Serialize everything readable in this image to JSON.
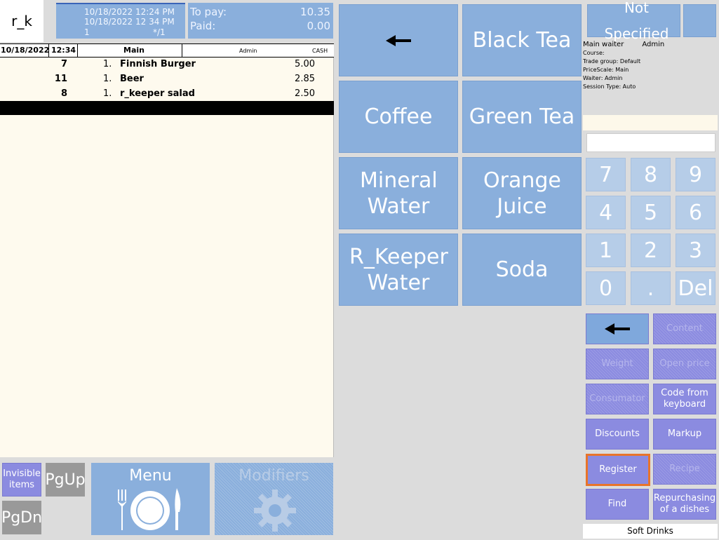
{
  "app": {
    "logo_text": "r_k"
  },
  "header": {
    "time_opened": "10/18/2022 12:24 PM",
    "time_current": "10/18/2022 12 34 PM",
    "guest_count": "1",
    "table_info": "*/1",
    "to_pay_label": "To pay:",
    "to_pay_value": "10.35",
    "paid_label": "Paid:",
    "paid_value": "0.00"
  },
  "order": {
    "date": "10/18/2022",
    "time": "12:34",
    "hall": "Main",
    "waiter": "Admin",
    "currency": "CASH",
    "items": [
      {
        "code": "7",
        "qty": "1.",
        "name": "Finnish Burger",
        "price": "5.00"
      },
      {
        "code": "11",
        "qty": "1.",
        "name": "Beer",
        "price": "2.85"
      },
      {
        "code": "8",
        "qty": "1.",
        "name": "r_keeper salad",
        "price": "2.50"
      }
    ]
  },
  "menu_grid": {
    "back_icon": "left-arrow-icon",
    "items": [
      "Black Tea",
      "Coffee",
      "Green Tea",
      "Mineral Water",
      "Orange Juice",
      "R_Keeper Water",
      "Soda"
    ]
  },
  "right_panel": {
    "customer": "Not Specified",
    "main_waiter_label": "Main waiter",
    "main_waiter_value": "Admin",
    "course_line": "Course:",
    "trade_group_line": "Trade group: Default",
    "price_scale_line": "PriceScale: Main",
    "waiter_line": "Waiter: Admin",
    "session_type_line": "Session Type: Auto"
  },
  "keypad": {
    "keys": [
      "7",
      "8",
      "9",
      "4",
      "5",
      "6",
      "1",
      "2",
      "3",
      "0",
      ".",
      "Del"
    ]
  },
  "functions": {
    "back_icon": "left-arrow-icon",
    "content": "Content",
    "weight": "Weight",
    "open_price": "Open price",
    "consumator": "Consumator",
    "code_from_keyboard": "Code from keyboard",
    "discounts": "Discounts",
    "markup": "Markup",
    "register": "Register",
    "recipe": "Recipe",
    "find": "Find",
    "repurchasing": "Repurchasing of a dishes",
    "category": "Soft Drinks"
  },
  "bottom": {
    "invisible_items": "Invisible items",
    "pgup": "PgUp",
    "pgdn": "PgDn",
    "menu": "Menu",
    "modifiers": "Modifiers"
  },
  "colors": {
    "tile": "#8aafdc",
    "function": "#8b8be0",
    "keypad": "#b6cde8",
    "highlight": "#e8742a"
  }
}
